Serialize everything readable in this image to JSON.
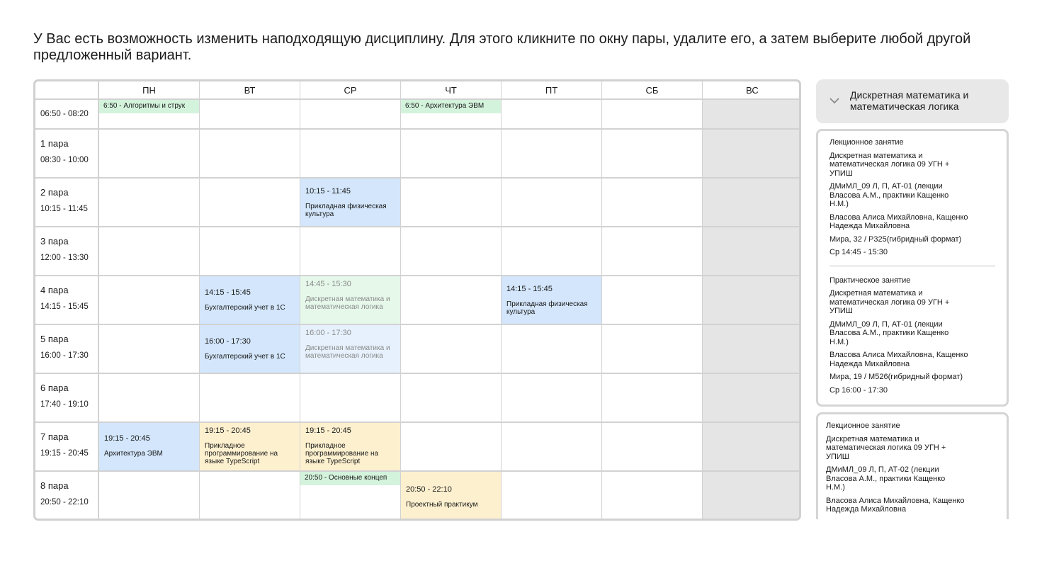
{
  "intro_text": "У Вас есть возможность изменить наподходящую дисциплину. Для этого кликните по окну пары, удалите его, а затем выберите любой другой предложенный вариант.",
  "days": [
    "ПН",
    "ВТ",
    "СР",
    "ЧТ",
    "ПТ",
    "СБ",
    "ВС"
  ],
  "slots": [
    {
      "name": "",
      "time": "06:50 - 08:20"
    },
    {
      "name": "1 пара",
      "time": "08:30 - 10:00"
    },
    {
      "name": "2 пара",
      "time": "10:15 - 11:45"
    },
    {
      "name": "3 пара",
      "time": "12:00 - 13:30"
    },
    {
      "name": "4 пара",
      "time": "14:15 - 15:45"
    },
    {
      "name": "5 пара",
      "time": "16:00 - 17:30"
    },
    {
      "name": "6 пара",
      "time": "17:40 - 19:10"
    },
    {
      "name": "7 пара",
      "time": "19:15 - 20:45"
    },
    {
      "name": "8 пара",
      "time": "20:50 - 22:10"
    }
  ],
  "events": {
    "mon_early": "6:50 - Алгоритмы и струк",
    "thu_early": "6:50 - Архитектура ЭВМ",
    "wed_2": {
      "time": "10:15 - 11:45",
      "title": "Прикладная физическая культура"
    },
    "tue_4": {
      "time": "14:15 - 15:45",
      "title": "Бухгалтерский учет в 1С"
    },
    "wed_4": {
      "time": "14:45 - 15:30",
      "title": "Дискретная математика и математическая логика"
    },
    "fri_4": {
      "time": "14:15 - 15:45",
      "title": "Прикладная физическая культура"
    },
    "tue_5": {
      "time": "16:00 - 17:30",
      "title": "Бухгалтерский учет в 1С"
    },
    "wed_5": {
      "time": "16:00 - 17:30",
      "title": "Дискретная математика и математическая логика"
    },
    "mon_7": {
      "time": "19:15 - 20:45",
      "title": "Архитектура ЭВМ"
    },
    "tue_7": {
      "time": "19:15 - 20:45",
      "title": "Прикладное программирование на языке TypeScript"
    },
    "wed_7": {
      "time": "19:15 - 20:45",
      "title": "Прикладное программирование на языке TypeScript"
    },
    "wed_8_strip": "20:50 - Основные концеп",
    "thu_8": {
      "time": "20:50 - 22:10",
      "title": "Проектный практикум"
    }
  },
  "side": {
    "title": "Дискретная математика и математическая логика",
    "card1": {
      "lecture": {
        "type": "Лекционное занятие",
        "discipline": "Дискретная математика и математическая логика 09 УГН + УПИШ",
        "group": "ДМиМЛ_09 Л, П, АТ-01 (лекции Власова А.М., практики Кащенко Н.М.)",
        "teachers": "Власова Алиса Михайловна, Кащенко Надежда Михайловна",
        "place": "Мира, 32 / Р325(гибридный формат)",
        "when": "Ср 14:45 - 15:30"
      },
      "practice": {
        "type": "Практическое занятие",
        "discipline": "Дискретная математика и математическая логика 09 УГН + УПИШ",
        "group": "ДМиМЛ_09 Л, П, АТ-01 (лекции Власова А.М., практики Кащенко Н.М.)",
        "teachers": "Власова Алиса Михайловна, Кащенко Надежда Михайловна",
        "place": "Мира, 19 / М526(гибридный формат)",
        "when": "Ср 16:00 - 17:30"
      }
    },
    "card2": {
      "lecture": {
        "type": "Лекционное занятие",
        "discipline": "Дискретная математика и математическая логика 09 УГН + УПИШ",
        "group": "ДМиМЛ_09 Л, П, АТ-02 (лекции Власова А.М., практики Кащенко Н.М.)",
        "teachers": "Власова Алиса Михайловна, Кащенко Надежда Михайловна"
      }
    }
  }
}
